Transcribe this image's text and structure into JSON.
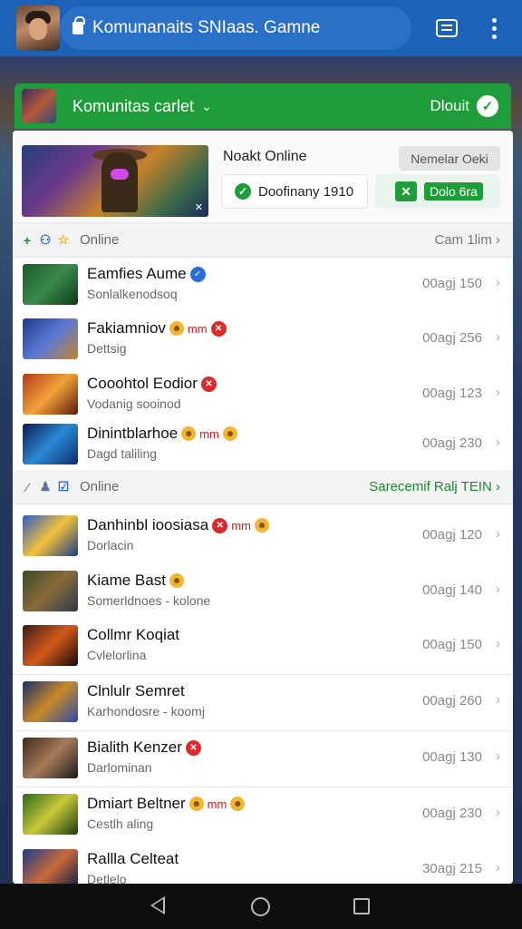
{
  "app": {
    "title": "Komunanaits SNIaas. Gamne"
  },
  "community": {
    "name": "Komunitas carlet",
    "about": "Dlouit"
  },
  "featured": {
    "title": "Noakt Online",
    "button": "Nemelar Oeki",
    "status": "Doofinany 1910",
    "play": "Dolo 6ra"
  },
  "sections": [
    {
      "label": "Online",
      "right": "Cam 1lim"
    },
    {
      "label": "Online",
      "right": "Sarecemif Ralj TEIN"
    }
  ],
  "rows": [
    {
      "title": "Eamfies Aume",
      "badges": [
        "blue"
      ],
      "subtitle": "Sonlalkenodsoq",
      "meta": "00agj 150",
      "thumb": [
        "#1a5a2a",
        "#3a8a4a",
        "#0e3a1a"
      ]
    },
    {
      "title": "Fakiamniov",
      "badges": [
        "emoji",
        "text",
        "red"
      ],
      "badge_text": "mm",
      "subtitle": "Dettsig",
      "meta": "00agj 256",
      "thumb": [
        "#1a3a8a",
        "#5a7ad6",
        "#c8822a"
      ]
    },
    {
      "title": "Cooohtol Eodior",
      "badges": [
        "red"
      ],
      "subtitle": "Vodanig sooinod",
      "meta": "00agj 123",
      "thumb": [
        "#b23a1a",
        "#f2a23a",
        "#5a1a0a"
      ]
    },
    {
      "title": "Dinintblarhoe",
      "badges": [
        "emoji",
        "text",
        "emoji"
      ],
      "badge_text": "mm",
      "subtitle": "Dagd taliling",
      "meta": "00agj 230",
      "thumb": [
        "#0a1a4a",
        "#2a8ad6",
        "#0a2a6a"
      ]
    },
    {
      "title": "Danhinbl ioosiasa",
      "badges": [
        "red",
        "text",
        "emoji"
      ],
      "badge_text": "mm",
      "subtitle": "Dorlacin",
      "meta": "00agj 120",
      "thumb": [
        "#2a5ac8",
        "#f2c23a",
        "#1a3a8a"
      ]
    },
    {
      "title": "Kiame Bast",
      "badges": [
        "emoji"
      ],
      "subtitle": "Somerldnoes - kolone",
      "meta": "00agj 140",
      "thumb": [
        "#3a4a2a",
        "#8a6a3a",
        "#2a3a4a"
      ]
    },
    {
      "title": "Collmr Koqiat",
      "badges": [],
      "subtitle": "Cvlelorlina",
      "meta": "00agj 150",
      "thumb": [
        "#3a1a1a",
        "#d25a1a",
        "#1a0a0a"
      ]
    },
    {
      "title": "Clnlulr Semret",
      "badges": [],
      "subtitle": "Karhondosre - koomj",
      "meta": "00agj 260",
      "thumb": [
        "#1a2a6a",
        "#c88a2a",
        "#2a4aa8"
      ]
    },
    {
      "title": "Bialith Kenzer",
      "badges": [
        "red"
      ],
      "subtitle": "Darlominan",
      "meta": "00agj 130",
      "thumb": [
        "#3a2a1a",
        "#a87a5a",
        "#1a1a1a"
      ]
    },
    {
      "title": "Dmiart Beltner",
      "badges": [
        "emoji",
        "text",
        "emoji"
      ],
      "badge_text": "mm",
      "subtitle": "Cestlh aling",
      "meta": "00agj 230",
      "thumb": [
        "#2a6a1a",
        "#c8c83a",
        "#1a3a0a"
      ]
    },
    {
      "title": "Rallla Celteat",
      "badges": [],
      "subtitle": "Detlelo",
      "meta": "30agj 215",
      "thumb": [
        "#1a3a8a",
        "#c86a3a",
        "#0a1a4a"
      ]
    }
  ]
}
